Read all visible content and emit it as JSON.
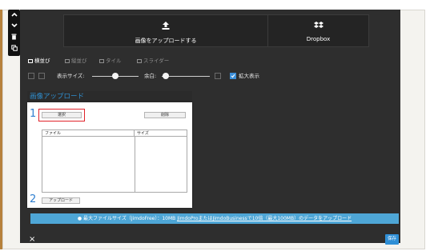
{
  "toolbar": {
    "upload_image_label": "画像をアップロードする",
    "dropbox_label": "Dropbox",
    "upload_icon": "upload-icon",
    "dropbox_icon": "dropbox-icon"
  },
  "side_toolbar": {
    "icons": [
      "chevron-up-icon",
      "chevron-down-icon",
      "trash-icon",
      "copy-icon"
    ]
  },
  "tabs": [
    {
      "label": "横並び",
      "active": true
    },
    {
      "label": "縦並び",
      "active": false
    },
    {
      "label": "タイル",
      "active": false
    },
    {
      "label": "スライダー",
      "active": false
    }
  ],
  "options": {
    "display_size_label": "表示サイズ:",
    "margin_label": "余白:",
    "zoom_label": "拡大表示",
    "zoom_checked": true,
    "display_size_level": 0.5,
    "margin_level": 0.05
  },
  "upload_dialog": {
    "title": "画像アップロード",
    "step1": "1",
    "select_button": "選択",
    "delete_button": "削除",
    "col_file": "ファイル",
    "col_size": "サイズ",
    "step2": "2",
    "upload_button": "アップロード"
  },
  "info_bar": {
    "text": "最大ファイルサイズ（JimdoFree）：10MB",
    "link": "JimdoProまたはJimdoBusinessで10倍（最大100MB）のデータをアップロード"
  },
  "footer": {
    "close_label": "×",
    "save_label": "保存"
  },
  "colors": {
    "panel_bg": "#2e2e2e",
    "accent_blue": "#4ea6d6",
    "save_blue": "#2f8fd6",
    "highlight_red": "#e0222a"
  }
}
